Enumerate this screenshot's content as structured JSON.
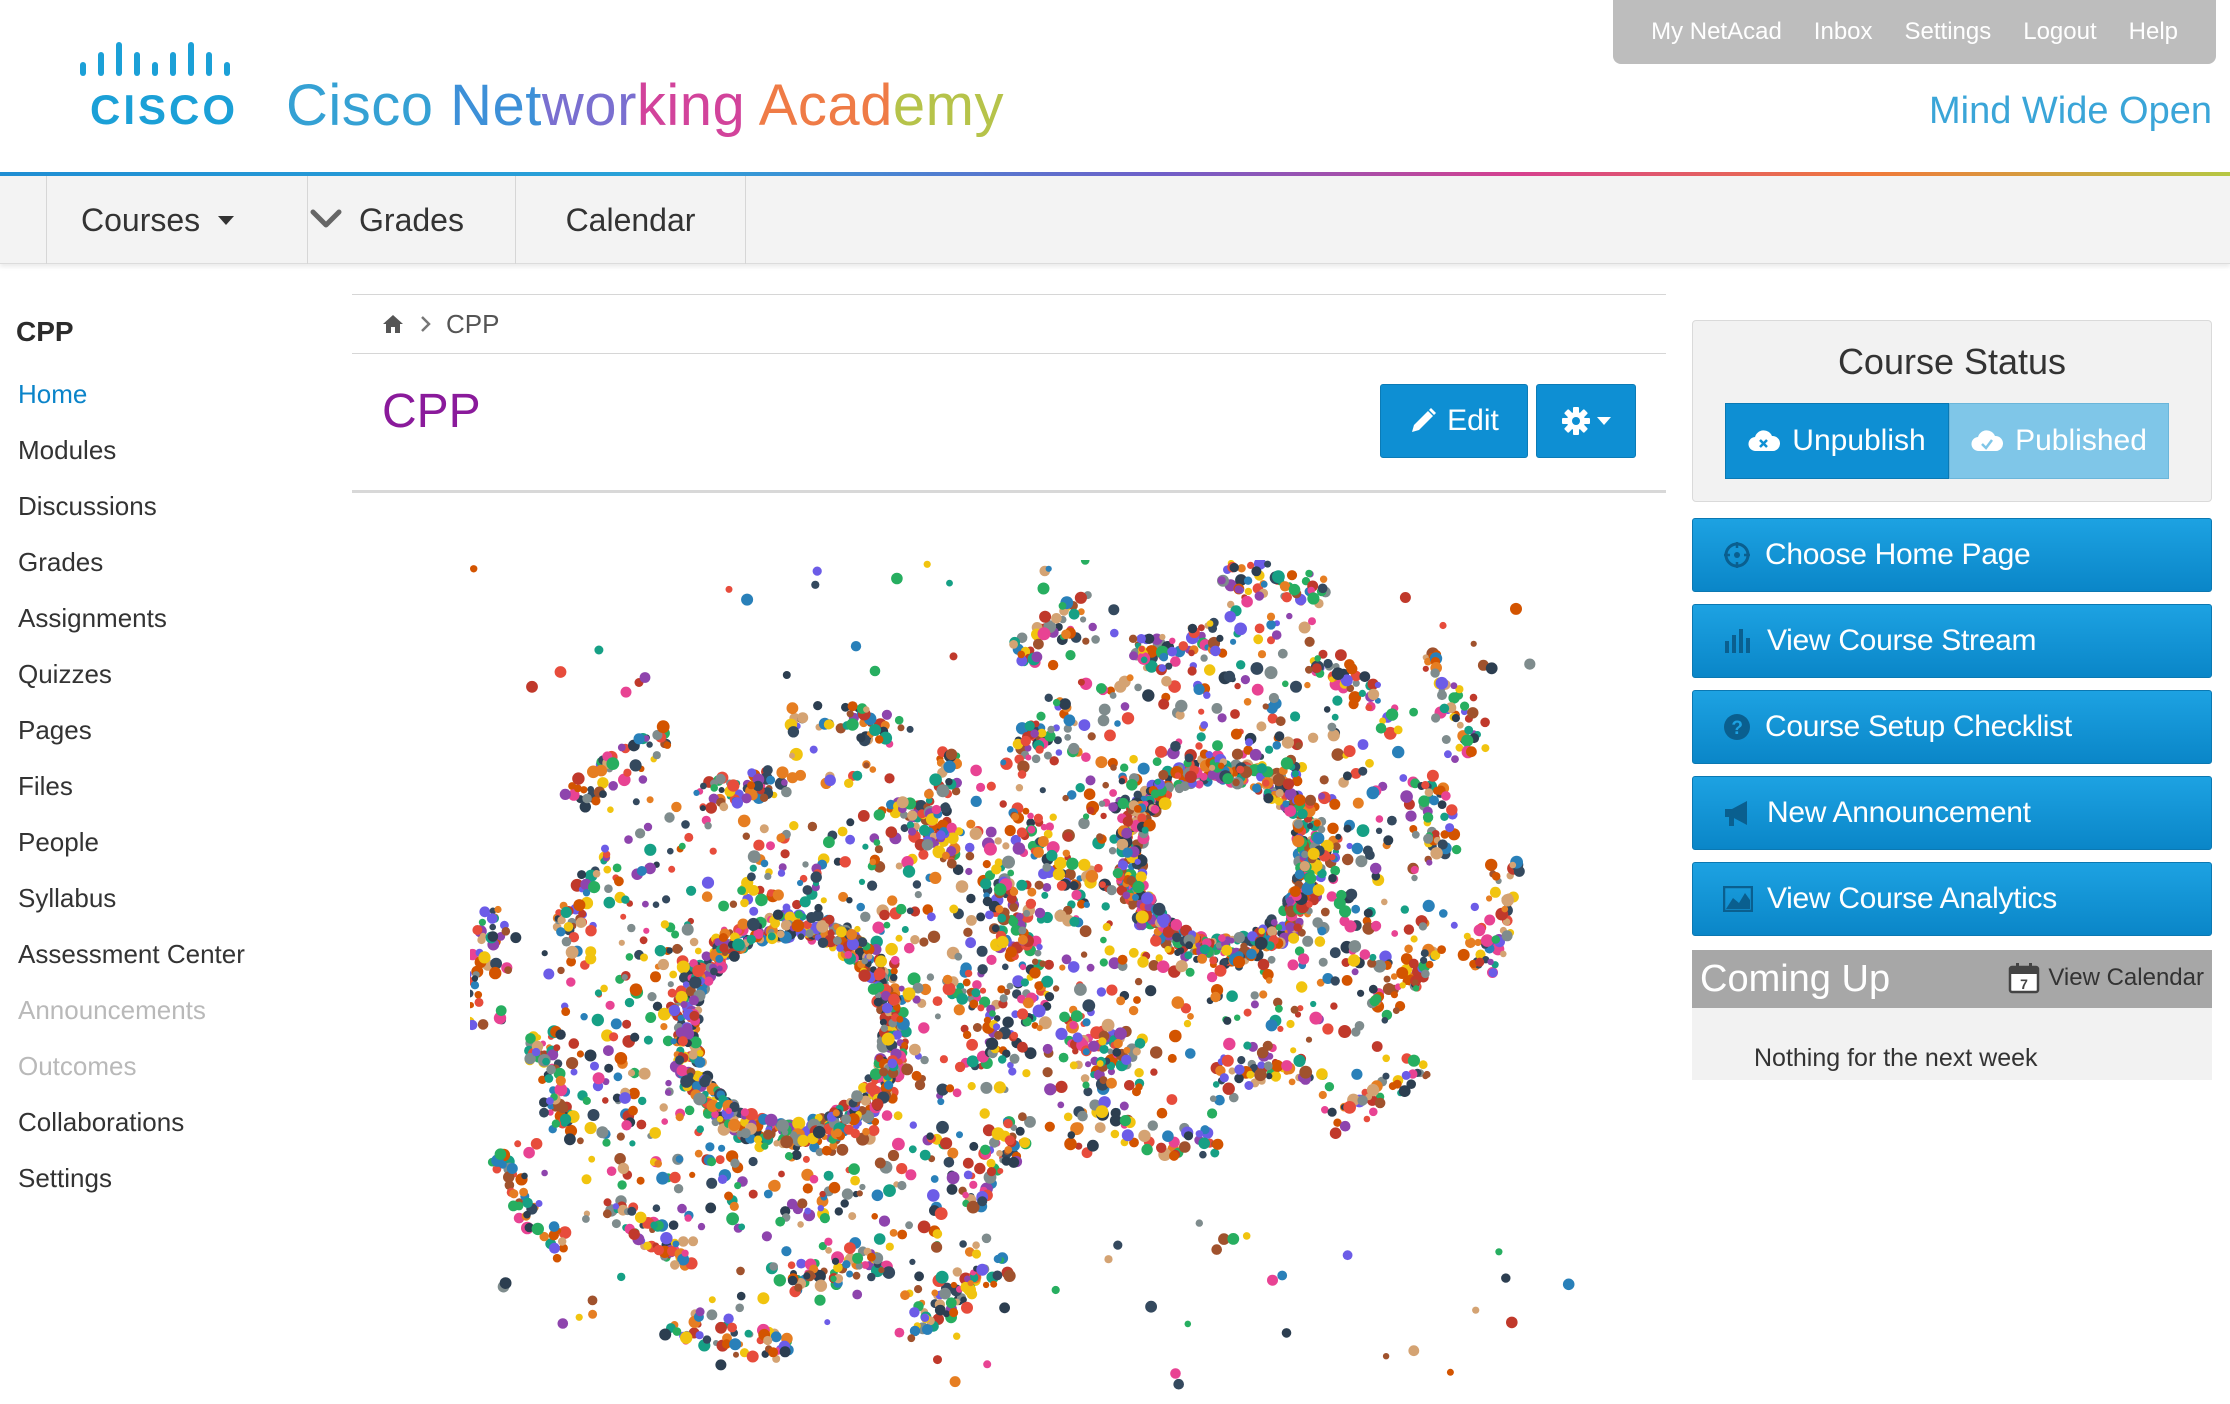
{
  "header": {
    "logo_text": "CISCO",
    "brand": {
      "word1": "Cisco",
      "word2a": "Net",
      "word2b": "wor",
      "word2c": "king",
      "word3a": "Acad",
      "word3b": "emy"
    },
    "tagline": "Mind Wide Open",
    "utility_links": [
      "My NetAcad",
      "Inbox",
      "Settings",
      "Logout",
      "Help"
    ]
  },
  "nav": {
    "courses": "Courses",
    "grades": "Grades",
    "calendar": "Calendar"
  },
  "sidebar": {
    "course_code": "CPP",
    "items": [
      {
        "label": "Home",
        "state": "active"
      },
      {
        "label": "Modules",
        "state": "normal"
      },
      {
        "label": "Discussions",
        "state": "normal"
      },
      {
        "label": "Grades",
        "state": "normal"
      },
      {
        "label": "Assignments",
        "state": "normal"
      },
      {
        "label": "Quizzes",
        "state": "normal"
      },
      {
        "label": "Pages",
        "state": "normal"
      },
      {
        "label": "Files",
        "state": "normal"
      },
      {
        "label": "People",
        "state": "normal"
      },
      {
        "label": "Syllabus",
        "state": "normal"
      },
      {
        "label": "Assessment Center",
        "state": "normal"
      },
      {
        "label": "Announcements",
        "state": "disabled"
      },
      {
        "label": "Outcomes",
        "state": "disabled"
      },
      {
        "label": "Collaborations",
        "state": "normal"
      },
      {
        "label": "Settings",
        "state": "normal"
      }
    ]
  },
  "main": {
    "breadcrumb": "CPP",
    "title": "CPP",
    "edit_label": "Edit"
  },
  "right": {
    "course_status_title": "Course Status",
    "unpublish_label": "Unpublish",
    "published_label": "Published",
    "actions": {
      "choose_home": "Choose Home Page",
      "stream": "View Course Stream",
      "checklist": "Course Setup Checklist",
      "announcement": "New Announcement",
      "analytics": "View Course Analytics"
    },
    "coming_up_title": "Coming Up",
    "view_calendar": "View Calendar",
    "calendar_icon_day": "7",
    "nothing_text": "Nothing for the next week"
  },
  "colors": {
    "accent_blue": "#0e8fd3",
    "published_blue": "#7fc6e8",
    "title_purple": "#8a1a9b",
    "active_link": "#0b84c9"
  }
}
